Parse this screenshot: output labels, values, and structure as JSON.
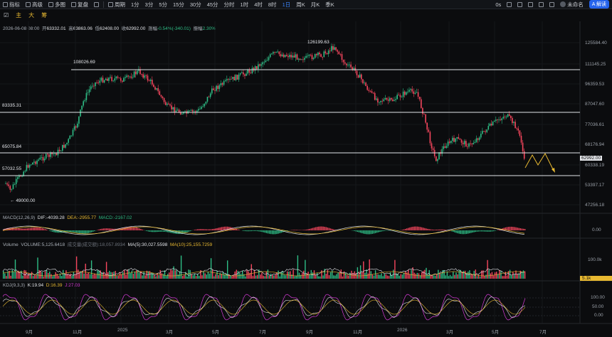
{
  "toolbar": {
    "items": [
      "指标",
      "高级",
      "多图",
      "复盘",
      "周期",
      "1分",
      "3分",
      "5分",
      "15分",
      "30分",
      "45分",
      "分时",
      "1时",
      "4时",
      "8时",
      "1日",
      "周K",
      "月K",
      "季K"
    ],
    "active": "1日",
    "right": [
      "0s",
      "未命名",
      "A 解读"
    ]
  },
  "drawbar": {
    "items": [
      "主",
      "大",
      "筹"
    ],
    "check": "☑"
  },
  "info": {
    "date": "2026-06-08 08:00",
    "open_label": "开",
    "open": "63332.01",
    "high_label": "高",
    "high": "63863.06",
    "low_label": "低",
    "low": "62408.00",
    "close_label": "收",
    "close": "62992.00",
    "change_label": "涨幅",
    "change": "-0.54%(-340.01)",
    "amp_label": "振幅",
    "amp": "2.30%"
  },
  "price_axis": [
    "125584.40",
    "111145.25",
    "96359.53",
    "87047.60",
    "77036.61",
    "68176.94",
    "60338.19",
    "53397.17",
    "47256.18"
  ],
  "last_price": "62992.00",
  "levels": [
    "108026.69",
    "83335.31",
    "65075.84",
    "57032.55"
  ],
  "annotations": {
    "high": "126199.63",
    "low": "49000.00"
  },
  "macd": {
    "label": "MACD(12,26,9)",
    "dif": "DIF:-4039.28",
    "dea": "DEA:-2955.77",
    "macd": "MACD:-2167.02",
    "axis": [
      "0.00"
    ]
  },
  "volume": {
    "label": "Volume",
    "vol": "VOLUME:5,125.6418",
    "extra": "成交量(成交额):18,057.8934",
    "ma5": "MA(5):30,027.5598",
    "ma10": "MA(10):25,155.7259",
    "axis": [
      "100.0k"
    ],
    "tag": "5.1k"
  },
  "kdj": {
    "label": "KDJ(9,3,3)",
    "k": "K:19.94",
    "d": "D:16.39",
    "j": "J:27.03",
    "axis": [
      "100.00",
      "50.00",
      "0.00"
    ]
  },
  "time_axis": [
    "9月",
    "11月",
    "2025",
    "3月",
    "5月",
    "7月",
    "9月",
    "11月",
    "2026",
    "3月",
    "5月",
    "7月"
  ],
  "colors": {
    "up": "#2ebd85",
    "down": "#f6465d",
    "accent": "#3b82f6",
    "gold": "#e8b931",
    "dif": "#e2e4e8",
    "dea": "#e8b931",
    "k_line": "#e2e4e8",
    "d_line": "#e8b931",
    "j_line": "#d63ad6"
  }
}
